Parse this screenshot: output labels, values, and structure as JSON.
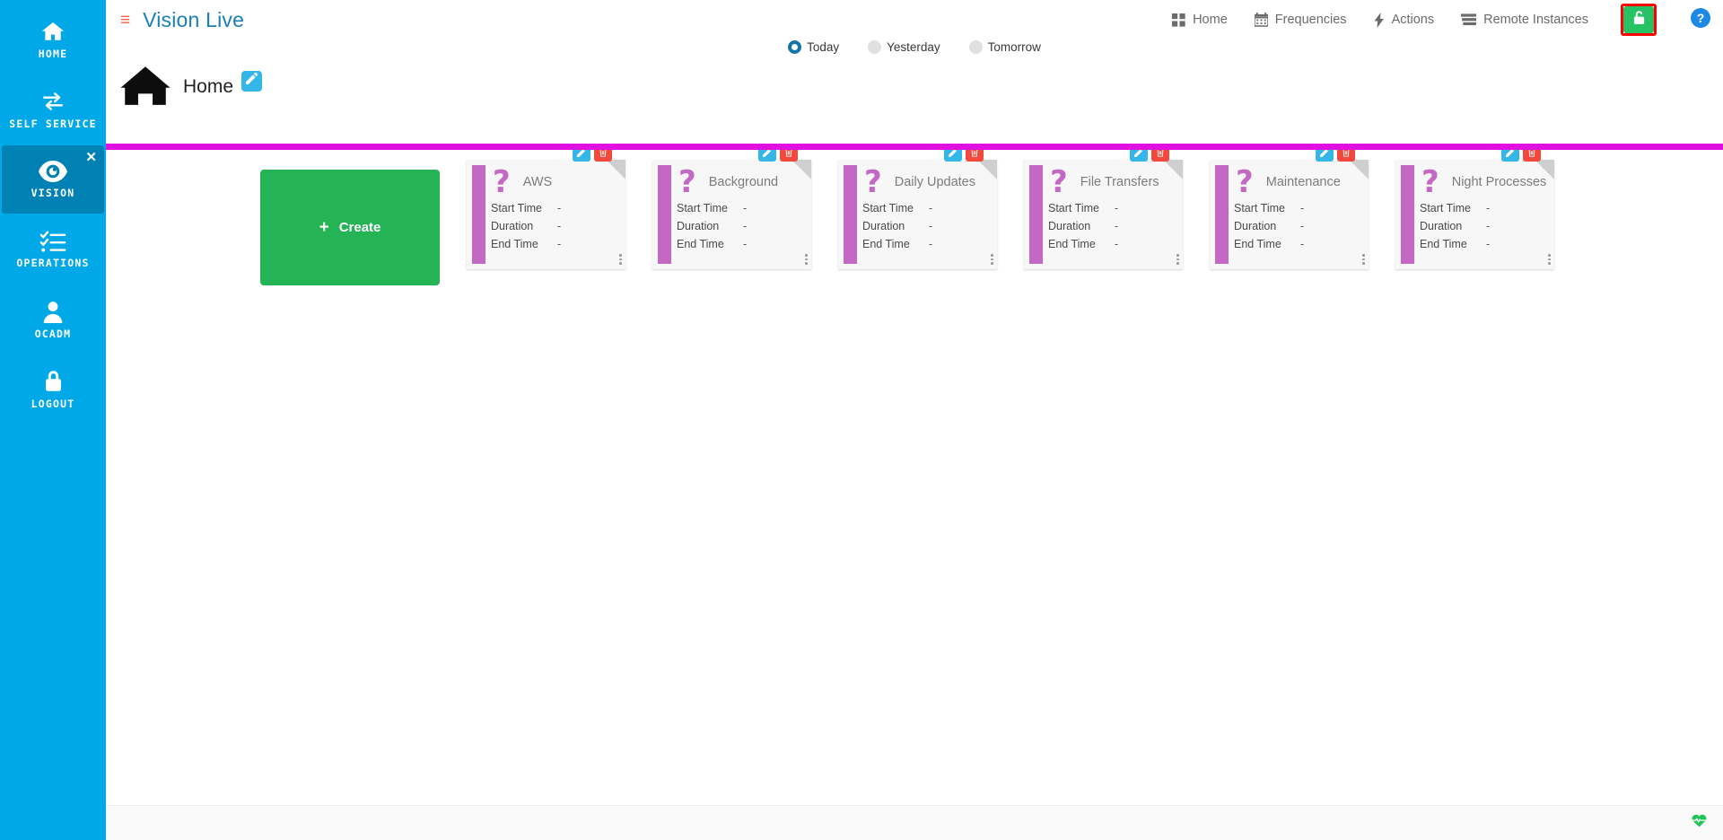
{
  "sidebar": {
    "items": [
      {
        "label": "HOME",
        "icon": "home-icon",
        "active": false
      },
      {
        "label": "SELF SERVICE",
        "icon": "exchange-icon",
        "active": false
      },
      {
        "label": "VISION",
        "icon": "eye-icon",
        "active": true
      },
      {
        "label": "OPERATIONS",
        "icon": "tasklist-icon",
        "active": false
      },
      {
        "label": "OCADM",
        "icon": "user-icon",
        "active": false
      },
      {
        "label": "LOGOUT",
        "icon": "lock-icon",
        "active": false
      }
    ],
    "close_label": "✕"
  },
  "topbar": {
    "menu_icon": "≡",
    "app_title": "Vision Live",
    "nav": [
      {
        "label": "Home",
        "icon": "grid-icon"
      },
      {
        "label": "Frequencies",
        "icon": "calendar-icon"
      },
      {
        "label": "Actions",
        "icon": "bolt-icon"
      },
      {
        "label": "Remote Instances",
        "icon": "server-icon"
      }
    ],
    "lock_icon": "unlock-icon",
    "help_icon": "question-circle-icon",
    "highlight_color": "#ff0000",
    "lock_color": "#26c263",
    "help_color": "#1e88e5"
  },
  "day_filter": {
    "options": [
      {
        "label": "Today",
        "selected": true
      },
      {
        "label": "Yesterday",
        "selected": false
      },
      {
        "label": "Tomorrow",
        "selected": false
      }
    ]
  },
  "breadcrumb": {
    "icon": "home-icon",
    "title": "Home",
    "edit_icon": "pencil-icon"
  },
  "divider_color": "#e011e0",
  "board": {
    "create_label": "Create",
    "create_plus": "+",
    "row_labels": {
      "start": "Start Time",
      "duration": "Duration",
      "end": "End Time"
    },
    "empty_value": "-",
    "status_icon": "question-mark-icon",
    "edit_icon": "pencil-icon",
    "delete_icon": "trash-icon",
    "menu_icon": "kebab-menu-icon",
    "accent_color": "#c368c3",
    "cards": [
      {
        "title": "AWS",
        "start_time": "-",
        "duration": "-",
        "end_time": "-"
      },
      {
        "title": "Background",
        "start_time": "-",
        "duration": "-",
        "end_time": "-"
      },
      {
        "title": "Daily Updates",
        "start_time": "-",
        "duration": "-",
        "end_time": "-"
      },
      {
        "title": "File Transfers",
        "start_time": "-",
        "duration": "-",
        "end_time": "-"
      },
      {
        "title": "Maintenance",
        "start_time": "-",
        "duration": "-",
        "end_time": "-"
      },
      {
        "title": "Night Processes",
        "start_time": "-",
        "duration": "-",
        "end_time": "-"
      }
    ]
  },
  "footer": {
    "status_icon": "heartbeat-icon",
    "status_color": "#21c45a"
  }
}
